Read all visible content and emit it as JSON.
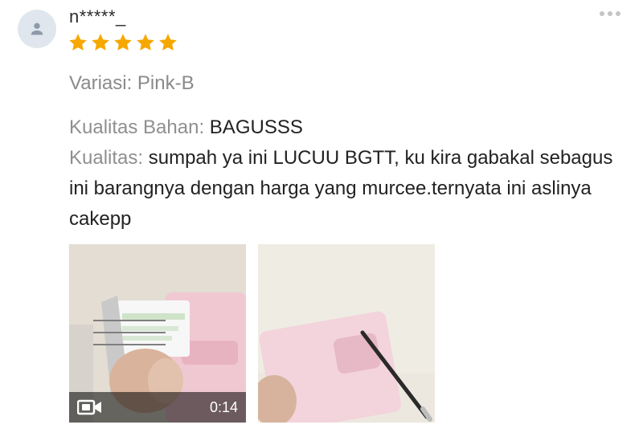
{
  "review": {
    "username": "n*****_",
    "rating": 5,
    "rating_color": "#f6a700",
    "variation": "Variasi: Pink-B",
    "lines": [
      {
        "key": "Kualitas Bahan:",
        "value": "BAGUSSS"
      },
      {
        "key": "Kualitas:",
        "value": "sumpah ya ini LUCUU BGTT, ku kira gabakal sebagus ini barangnya dengan harga yang murcee.ternyata ini aslinya cakepp"
      }
    ],
    "media": {
      "video_duration": "0:14"
    }
  }
}
